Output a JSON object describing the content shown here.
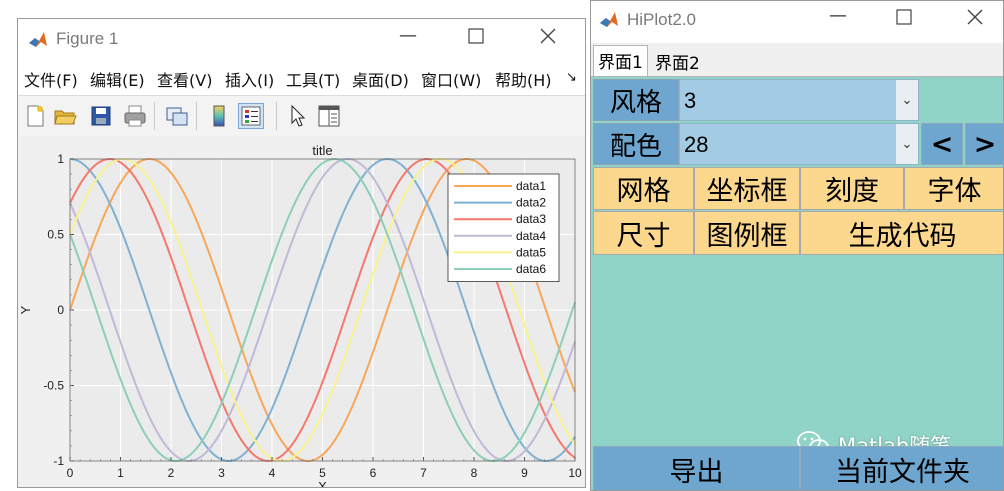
{
  "figure_window": {
    "title": "Figure 1",
    "menu": [
      "文件(F)",
      "编辑(E)",
      "查看(V)",
      "插入(I)",
      "工具(T)",
      "桌面(D)",
      "窗口(W)",
      "帮助(H)"
    ],
    "menu_overflow_icon": "dock-arrow-icon",
    "toolbar_icons": [
      "new-figure-icon",
      "open-file-icon",
      "save-icon",
      "print-icon",
      "link-plot-icon",
      "colorbar-icon",
      "legend-icon",
      "pointer-icon",
      "property-editor-icon"
    ]
  },
  "hiplot_window": {
    "title": "HiPlot2.0",
    "tabs": [
      "界面1",
      "界面2"
    ],
    "style_label": "风格",
    "style_value": "3",
    "colormap_label": "配色",
    "colormap_value": "28",
    "prev_button": "<",
    "next_button": ">",
    "grid_button": "网格",
    "axes_box_button": "坐标框",
    "ticks_button": "刻度",
    "font_button": "字体",
    "size_button": "尺寸",
    "legend_box_button": "图例框",
    "gen_code_button": "生成代码",
    "export_button": "导出",
    "current_folder_button": "当前文件夹",
    "watermark": "Matlab随笔",
    "colors": {
      "panel_bg": "#8fd4c6",
      "label_blue": "#6fa6cf",
      "dropdown_blue": "#a3cce4",
      "button_yellow": "#fcd88f"
    }
  },
  "chart_data": {
    "type": "line",
    "title": "title",
    "xlabel": "X",
    "ylabel": "Y",
    "xlim": [
      0,
      10
    ],
    "ylim": [
      -1,
      1
    ],
    "x_ticks": [
      "0",
      "1",
      "2",
      "3",
      "4",
      "5",
      "6",
      "7",
      "8",
      "9",
      "10"
    ],
    "y_ticks": [
      "1",
      "0.5",
      "0",
      "-0.5",
      "-1"
    ],
    "grid": true,
    "legend_position": "top-right",
    "series": [
      {
        "name": "data1",
        "function": "sin(x)",
        "color": "#f8a75a"
      },
      {
        "name": "data2",
        "function": "sin(x+1.5708)",
        "color": "#7fb1d4"
      },
      {
        "name": "data3",
        "function": "sin(x+0.7854)",
        "color": "#f5786c"
      },
      {
        "name": "data4",
        "function": "sin(x+2.3562)",
        "color": "#c0b9d8"
      },
      {
        "name": "data5",
        "function": "sin(x+0.5236)",
        "color": "#f8f38e"
      },
      {
        "name": "data6",
        "function": "sin(x+2.618)",
        "color": "#8ccfb8"
      }
    ]
  }
}
